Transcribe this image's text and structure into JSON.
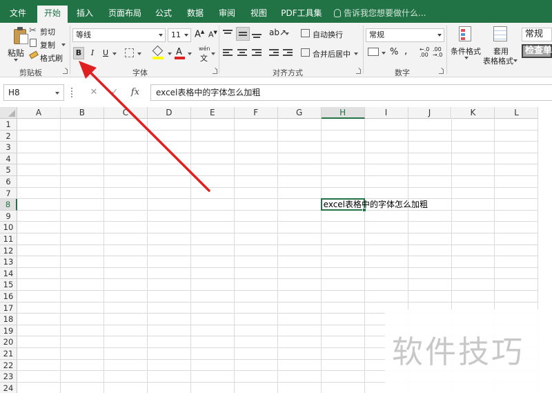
{
  "tabs": [
    "文件",
    "开始",
    "插入",
    "页面布局",
    "公式",
    "数据",
    "审阅",
    "视图",
    "PDF工具集"
  ],
  "active_tab": "开始",
  "tell_me": "告诉我您想要做什么...",
  "clipboard": {
    "paste": "粘贴",
    "cut": "剪切",
    "copy": "复制",
    "format_painter": "格式刷",
    "label": "剪贴板"
  },
  "font": {
    "name": "等线",
    "size": "11",
    "grow": "A",
    "shrink": "A",
    "bold": "B",
    "italic": "I",
    "underline": "U",
    "font_color": "A",
    "wen": "wén",
    "label": "字体"
  },
  "alignment": {
    "wrap_text": "自动换行",
    "merge_center": "合并后居中",
    "label": "对齐方式"
  },
  "number": {
    "format": "常规",
    "percent": "%",
    "comma": ",",
    "label": "数字"
  },
  "styles": {
    "conditional": "条件格式",
    "table_format_1": "套用",
    "table_format_2": "表格格式",
    "style_normal": "常规",
    "style_check": "检查单"
  },
  "formula_bar": {
    "name_box": "H8",
    "cancel": "✕",
    "enter": "✓",
    "fx": "fx",
    "formula": "excel表格中的字体怎么加粗"
  },
  "sheet": {
    "columns": [
      "A",
      "B",
      "C",
      "D",
      "E",
      "F",
      "G",
      "H",
      "I",
      "J",
      "K",
      "L"
    ],
    "selected_column": "H",
    "rows": [
      "1",
      "2",
      "3",
      "4",
      "5",
      "6",
      "7",
      "8",
      "9",
      "10",
      "11",
      "12",
      "13",
      "14",
      "15",
      "16",
      "17",
      "18",
      "19",
      "20",
      "21",
      "22",
      "23",
      "24"
    ],
    "selected_row": "8",
    "cell_h8": "excel表格中的字体怎么加粗"
  },
  "watermark": "软件技巧",
  "colors": {
    "excel_green": "#217346",
    "annotation_red": "#e02020"
  }
}
